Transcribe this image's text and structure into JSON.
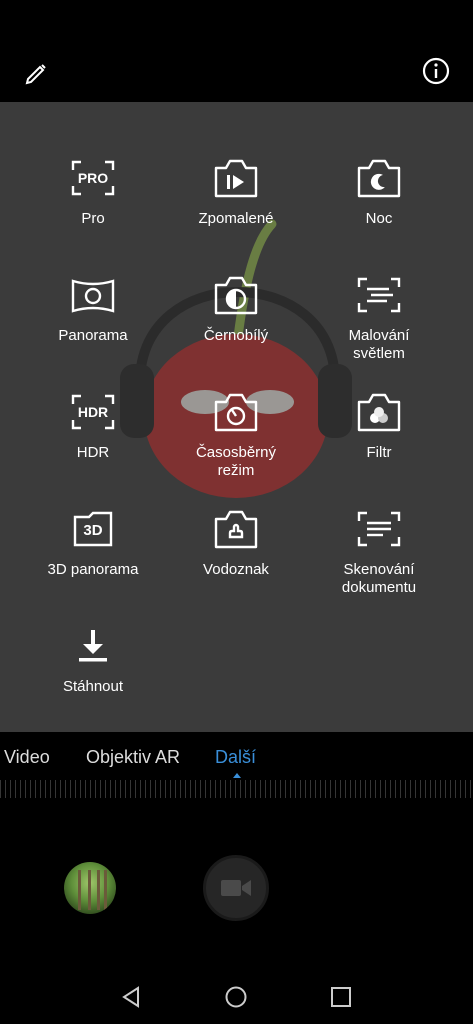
{
  "top": {
    "edit_icon": "edit-pencil-icon",
    "info_icon": "info-icon"
  },
  "modes": [
    {
      "label": "Pro",
      "icon": "pro-icon"
    },
    {
      "label": "Zpomalené",
      "icon": "slow-motion-icon"
    },
    {
      "label": "Noc",
      "icon": "night-icon"
    },
    {
      "label": "Panorama",
      "icon": "panorama-icon"
    },
    {
      "label": "Černobílý",
      "icon": "monochrome-icon"
    },
    {
      "label": "Malování\nsvětlem",
      "icon": "light-painting-icon"
    },
    {
      "label": "HDR",
      "icon": "hdr-icon"
    },
    {
      "label": "Časosběrný\nrežim",
      "icon": "timelapse-icon"
    },
    {
      "label": "Filtr",
      "icon": "filter-icon"
    },
    {
      "label": "3D panorama",
      "icon": "3d-panorama-icon"
    },
    {
      "label": "Vodoznak",
      "icon": "watermark-icon"
    },
    {
      "label": "Skenování\ndokumentu",
      "icon": "document-scan-icon"
    },
    {
      "label": "Stáhnout",
      "icon": "download-icon"
    }
  ],
  "tabs": [
    {
      "label": "Video",
      "active": false
    },
    {
      "label": "Objektiv AR",
      "active": false
    },
    {
      "label": "Další",
      "active": true
    }
  ],
  "colors": {
    "accent": "#3a8fd9",
    "panel": "#3b3b3b"
  },
  "navbar": {
    "back_icon": "back-triangle-icon",
    "home_icon": "home-circle-icon",
    "recents_icon": "recents-square-icon"
  }
}
